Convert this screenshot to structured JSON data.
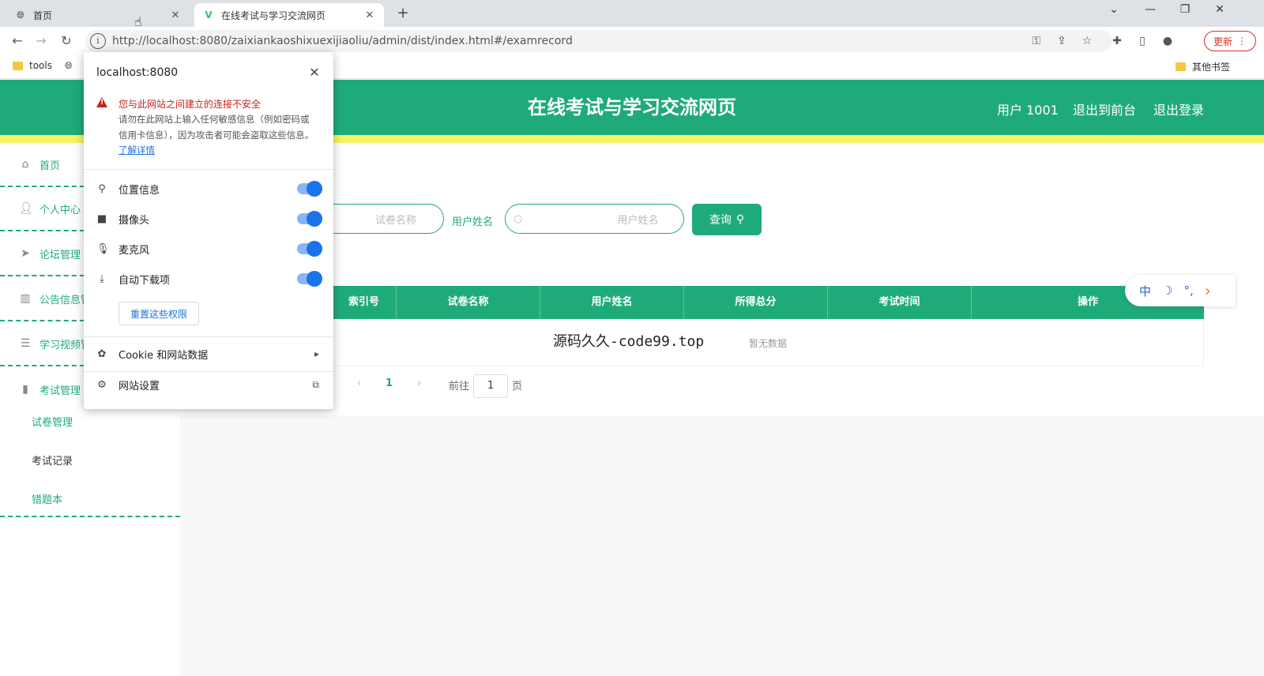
{
  "browser": {
    "tabs": [
      {
        "title": "首页",
        "favicon": "globe-icon"
      },
      {
        "title": "在线考试与学习交流网页",
        "favicon": "vue-icon"
      }
    ],
    "tab_close": "✕",
    "new_tab": "+",
    "url": "http://localhost:8080/zaixiankaoshixuexijiaoliu/admin/dist/index.html#/examrecord",
    "update_label": "更新",
    "bookmarks": [
      {
        "label": "tools"
      }
    ],
    "other_bookmarks": "其他书签"
  },
  "site_info": {
    "host": "localhost:8080",
    "warning_title": "您与此网站之间建立的连接不安全",
    "warning_body": "请勿在此网站上输入任何敏感信息（例如密码或信用卡信息），因为攻击者可能会盗取这些信息。",
    "learn_more": "了解详情",
    "permissions": [
      {
        "label": "位置信息",
        "icon": "location-pin-icon",
        "enabled": true
      },
      {
        "label": "摄像头",
        "icon": "camera-icon",
        "enabled": true
      },
      {
        "label": "麦克风",
        "icon": "microphone-icon",
        "enabled": true
      },
      {
        "label": "自动下载项",
        "icon": "download-icon",
        "enabled": true
      }
    ],
    "reset_label": "重置这些权限",
    "cookie_label": "Cookie 和网站数据",
    "settings_label": "网站设置"
  },
  "app": {
    "title": "在线考试与学习交流网页",
    "header_links": [
      "用户 1001",
      "退出到前台",
      "退出登录"
    ],
    "accent_color": "#1fab79"
  },
  "sidebar": {
    "items": [
      {
        "label": "首页",
        "icon": "home-icon"
      },
      {
        "label": "个人中心",
        "icon": "user-icon"
      },
      {
        "label": "论坛管理",
        "icon": "send-icon"
      },
      {
        "label": "公告信息管理",
        "icon": "notice-icon"
      },
      {
        "label": "学习视频管理",
        "icon": "sliders-icon"
      },
      {
        "label": "考试管理",
        "icon": "bar-chart-icon"
      }
    ],
    "sub_items": [
      {
        "label": "试卷管理"
      },
      {
        "label": "考试记录"
      },
      {
        "label": "错题本"
      }
    ]
  },
  "search": {
    "paper_placeholder": "试卷名称",
    "user_label": "用户姓名",
    "user_placeholder": "用户姓名",
    "query_label": "查询"
  },
  "table": {
    "columns": [
      "索引号",
      "试卷名称",
      "用户姓名",
      "所得总分",
      "考试时间",
      "操作"
    ],
    "empty_text": "暂无数据"
  },
  "pagination": {
    "current_page": "1",
    "goto_label": "前往",
    "goto_value": "1",
    "page_suffix": "页"
  },
  "overlay_text": "源码久久-code99.top",
  "floating_tools": [
    "中",
    "☽",
    "°,",
    "›"
  ]
}
